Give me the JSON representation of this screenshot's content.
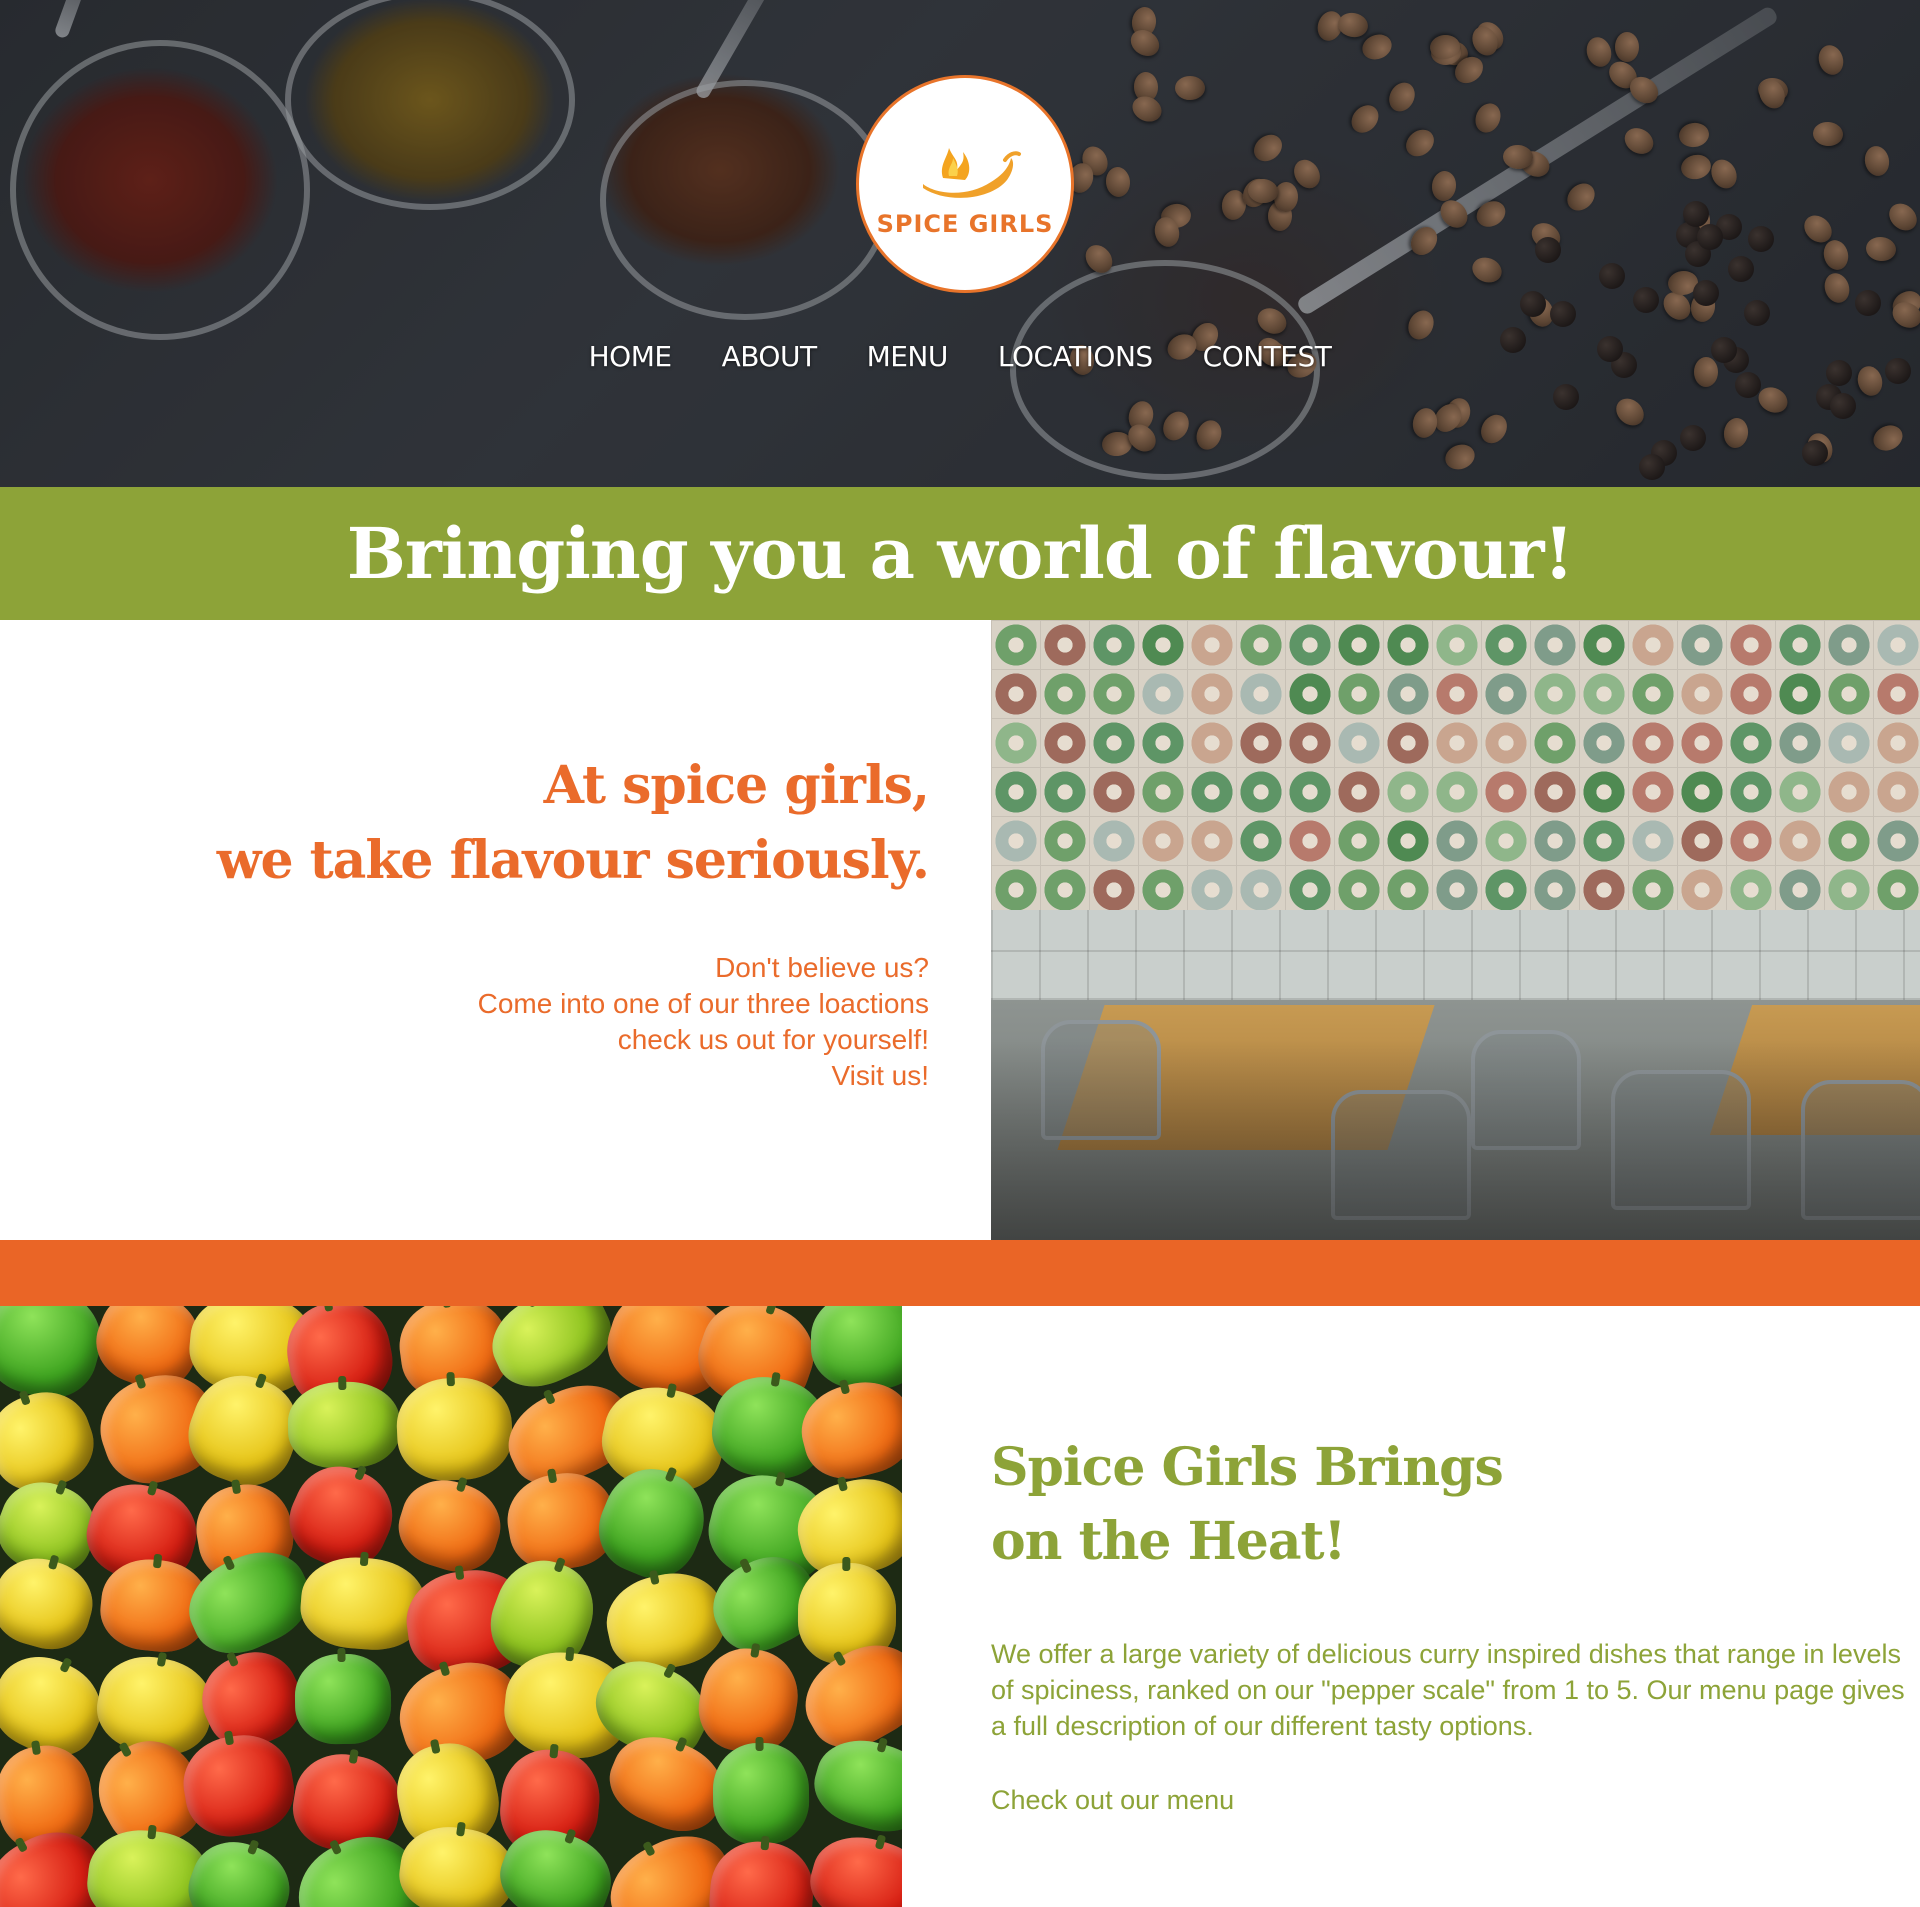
{
  "brand": {
    "name": "SPICE GIRLS",
    "logo_icon": "chili-flame-icon",
    "accent_orange": "#ea6b2b",
    "accent_green": "#8da338"
  },
  "nav": {
    "items": [
      {
        "label": "HOME"
      },
      {
        "label": "ABOUT"
      },
      {
        "label": "MENU"
      },
      {
        "label": "LOCATIONS"
      },
      {
        "label": "CONTEST"
      }
    ]
  },
  "banner": {
    "text": "Bringing you a world of flavour!"
  },
  "intro": {
    "heading_line1": "At spice girls,",
    "heading_line2": "we take flavour seriously.",
    "body_lines": [
      "Don't believe us?",
      "Come into one of our three loactions",
      "check us out for yourself!",
      "Visit us!"
    ]
  },
  "heat": {
    "heading_line1": "Spice Girls Brings",
    "heading_line2": "on the Heat!",
    "body": "We offer a large variety of delicious curry inspired dishes that range in levels of spiciness, ranked on our \"pepper scale\" from 1 to 5. Our menu page gives a full description of our different tasty options.",
    "link": "Check out our menu"
  }
}
